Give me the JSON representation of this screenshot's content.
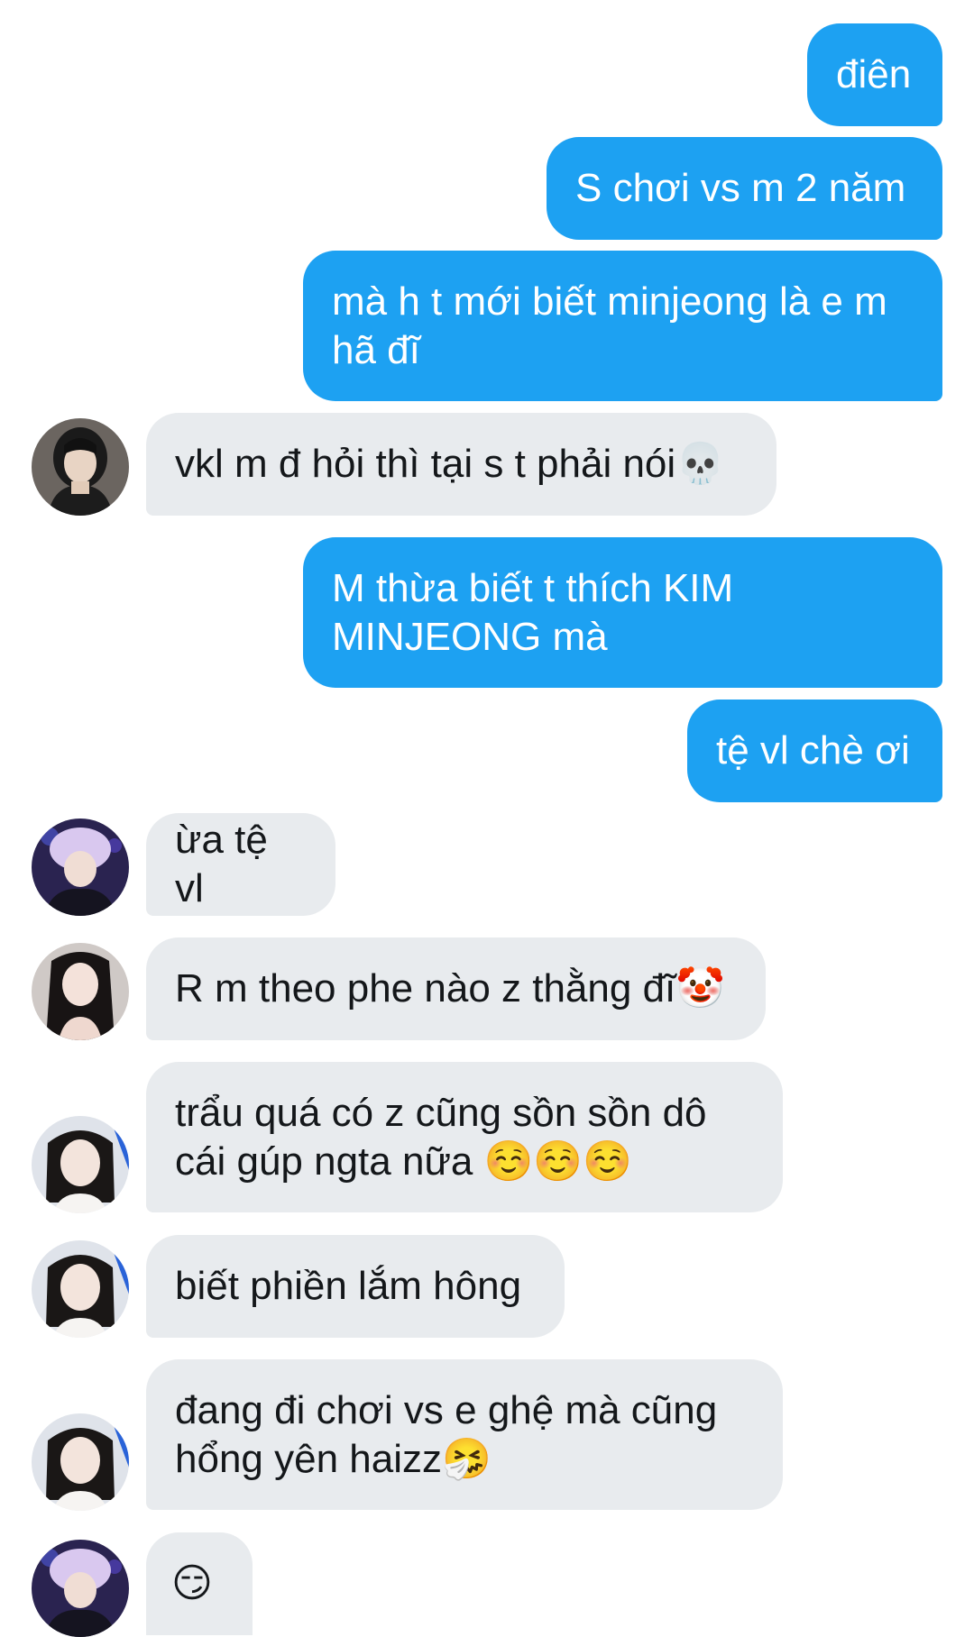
{
  "messages": [
    {
      "side": "out",
      "text": "điên"
    },
    {
      "side": "out",
      "text": "S chơi vs m 2 năm"
    },
    {
      "side": "out",
      "text": "mà h t mới biết minjeong là e m hã đĩ"
    },
    {
      "side": "in",
      "avatar": "avatar-1",
      "text": "vkl m đ hỏi thì tại s t phải nói💀"
    },
    {
      "side": "out",
      "text": "M thừa biết t thích KIM MINJEONG mà"
    },
    {
      "side": "out",
      "text": "tệ vl chè ơi"
    },
    {
      "side": "in",
      "avatar": "avatar-2",
      "text": "ừa tệ vl"
    },
    {
      "side": "in",
      "avatar": "avatar-3",
      "text": "R m theo phe nào z thằng đĩ🤡"
    },
    {
      "side": "in",
      "avatar": "avatar-4",
      "text": "trẩu quá có z cũng sồn sồn dô cái gúp ngta nữa ☺️☺️☺️"
    },
    {
      "side": "in",
      "avatar": "avatar-4",
      "text": "biết phiền lắm hông"
    },
    {
      "side": "in",
      "avatar": "avatar-4",
      "text": "đang đi chơi vs e ghệ mà cũng hổng yên haizz🤧"
    },
    {
      "side": "in",
      "avatar": "avatar-2",
      "text": "😏"
    }
  ],
  "colors": {
    "outgoing_bubble": "#1da1f2",
    "incoming_bubble": "#e8ebee",
    "outgoing_text": "#ffffff",
    "incoming_text": "#14171a"
  }
}
